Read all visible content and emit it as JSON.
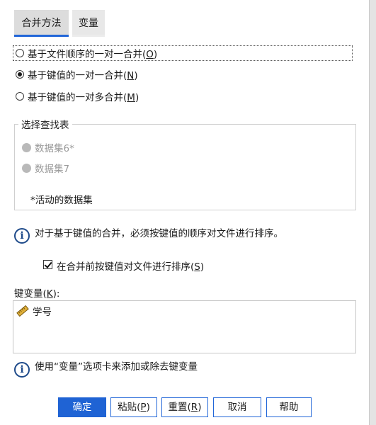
{
  "tabs": [
    {
      "label": "合并方法",
      "active": true
    },
    {
      "label": "变量",
      "active": false
    }
  ],
  "merge_methods": [
    {
      "label_prefix": "基于文件顺序的一对一合并(",
      "mnemonic": "O",
      "label_suffix": ")",
      "selected": false
    },
    {
      "label_prefix": "基于键值的一对一合并(",
      "mnemonic": "N",
      "label_suffix": ")",
      "selected": true
    },
    {
      "label_prefix": "基于键值的一对多合并(",
      "mnemonic": "M",
      "label_suffix": ")",
      "selected": false
    }
  ],
  "lookup_group": {
    "title": "选择查找表",
    "options": [
      "数据集6*",
      "数据集7"
    ],
    "note": "*活动的数据集"
  },
  "info_sort": "对于基于键值的合并，必须按键值的顺序对文件进行排序。",
  "sort_checkbox": {
    "label_prefix": "在合并前按键值对文件进行排序(",
    "mnemonic": "S",
    "label_suffix": ")",
    "checked": true
  },
  "key_variables": {
    "label_prefix": "键变量(",
    "mnemonic": "K",
    "label_suffix": "):",
    "items": [
      {
        "name": "学号",
        "icon": "ruler-icon"
      }
    ]
  },
  "info_vars": "使用“变量”选项卡来添加或除去键变量",
  "buttons": {
    "ok": "确定",
    "paste_prefix": "粘贴(",
    "paste_mn": "P",
    "paste_suffix": ")",
    "reset_prefix": "重置(",
    "reset_mn": "R",
    "reset_suffix": ")",
    "cancel": "取消",
    "help": "帮助"
  },
  "colors": {
    "accent": "#1f63d4",
    "info": "#1e4a8a"
  }
}
